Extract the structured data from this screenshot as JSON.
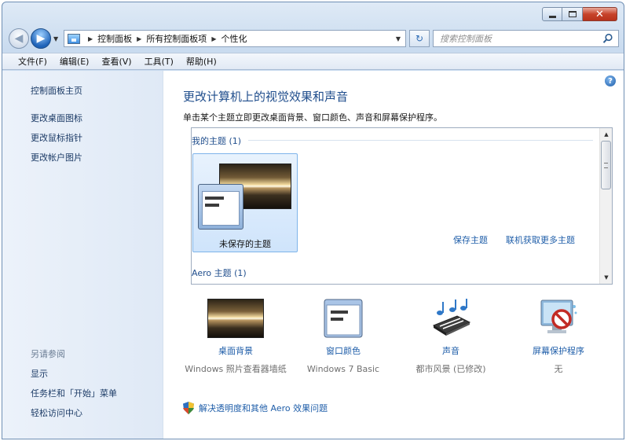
{
  "window": {
    "caption_close_glyph": "✕"
  },
  "nav": {
    "back_glyph": "◀",
    "forward_glyph": "▶",
    "breadcrumbs": [
      "控制面板",
      "所有控制面板项",
      "个性化"
    ],
    "search_placeholder": "搜索控制面板",
    "refresh_glyph": "↻"
  },
  "menu": [
    "文件(F)",
    "编辑(E)",
    "查看(V)",
    "工具(T)",
    "帮助(H)"
  ],
  "sidebar": {
    "home": "控制面板主页",
    "links": [
      "更改桌面图标",
      "更改鼠标指针",
      "更改帐户图片"
    ],
    "see_also_label": "另请参阅",
    "see_also": [
      "显示",
      "任务栏和「开始」菜单",
      "轻松访问中心"
    ]
  },
  "main": {
    "help_glyph": "?",
    "title": "更改计算机上的视觉效果和声音",
    "description": "单击某个主题立即更改桌面背景、窗口颜色、声音和屏幕保护程序。",
    "my_themes_label": "我的主题 (1)",
    "unsaved_theme_label": "未保存的主题",
    "save_theme": "保存主题",
    "more_themes_online": "联机获取更多主题",
    "aero_themes_label": "Aero 主题 (1)"
  },
  "settings": [
    {
      "name": "桌面背景",
      "value": "Windows 照片查看器墙纸",
      "icon": "desktop-background-icon"
    },
    {
      "name": "窗口颜色",
      "value": "Windows 7 Basic",
      "icon": "window-color-icon"
    },
    {
      "name": "声音",
      "value": "都市风景 (已修改)",
      "icon": "sound-icon"
    },
    {
      "name": "屏幕保护程序",
      "value": "无",
      "icon": "screensaver-icon"
    }
  ],
  "troubleshoot_link": "解决透明度和其他 Aero 效果问题",
  "colors": {
    "link": "#1f5ea9",
    "title": "#1f4d8c",
    "close_button": "#c7432b"
  }
}
